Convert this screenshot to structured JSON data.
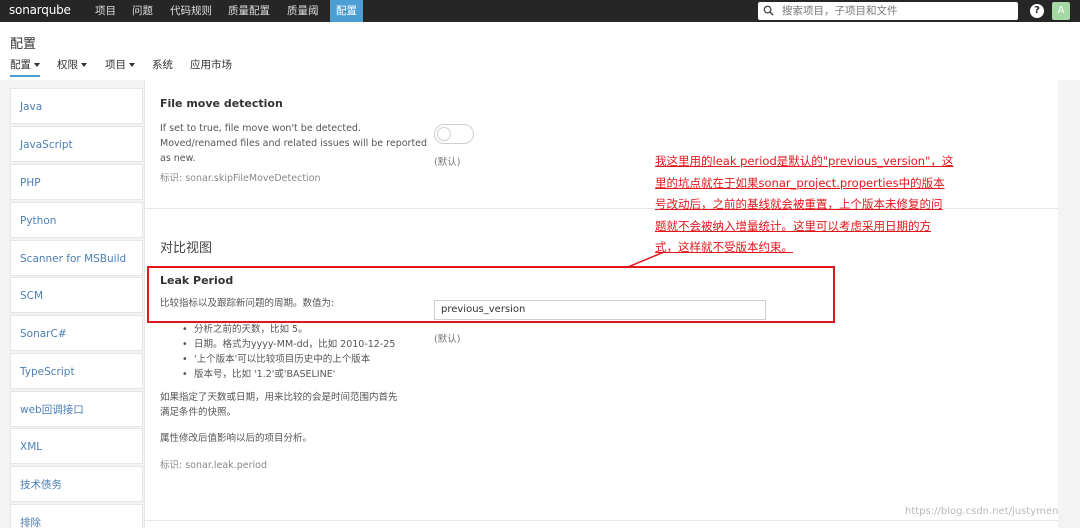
{
  "topbar": {
    "logo": "sonarqube",
    "nav": [
      "项目",
      "问题",
      "代码规则",
      "质量配置",
      "质量阈",
      "配置"
    ],
    "search_placeholder": "搜索项目，子项目和文件",
    "help": "?",
    "avatar": "A"
  },
  "header": {
    "title": "配置",
    "subnav": [
      "配置",
      "权限",
      "项目",
      "系统",
      "应用市场"
    ]
  },
  "sidebar": {
    "items": [
      "Java",
      "JavaScript",
      "PHP",
      "Python",
      "Scanner for MSBuild",
      "SCM",
      "SonarC#",
      "TypeScript",
      "web回调接口",
      "XML",
      "技术债务",
      "排除"
    ]
  },
  "file_move": {
    "title": "File move detection",
    "desc_lines": [
      "If set to true, file move won't be detected.",
      "Moved/renamed files and related issues will be reported",
      "as new."
    ],
    "key": "标识: sonar.skipFileMoveDetection",
    "default": "(默认)"
  },
  "compare": {
    "section_title": "对比视图",
    "leak_title": "Leak Period",
    "leak_desc": "比较指标以及跟踪新问题的周期。数值为:",
    "leak_value": "previous_version",
    "bullets": [
      "分析之前的天数，比如 5。",
      "日期。格式为yyyy-MM-dd，比如 2010-12-25",
      "'上个版本'可以比较项目历史中的上个版本",
      "版本号，比如 '1.2'或'BASELINE'"
    ],
    "note1_lines": [
      "如果指定了天数或日期，用来比较的会是时间范围内首先",
      "满足条件的快照。"
    ],
    "note2": "属性修改后值影响以后的项目分析。",
    "key": "标识: sonar.leak.period",
    "default": "(默认)"
  },
  "annotation": {
    "lines": [
      "我这里用的leak period是默认的\"previous_version\"，这",
      "里的坑点就在于如果sonar_project.properties中的版本",
      "号改动后，之前的基线就会被重置，上个版本未修复的问",
      "题就不会被纳入增量统计。这里可以考虑采用日期的方",
      "式，这样就不受版本约束。"
    ],
    "color": "#e3161c"
  },
  "watermark": "https://blog.csdn.net/justymen",
  "colors": {
    "accent": "#4b9fd5",
    "topbar": "#262626",
    "annotation": "#e3161c"
  }
}
